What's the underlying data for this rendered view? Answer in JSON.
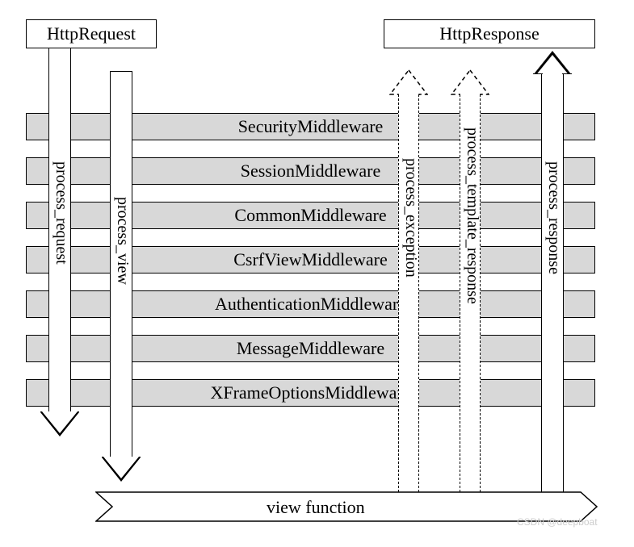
{
  "header": {
    "request_label": "HttpRequest",
    "response_label": "HttpResponse"
  },
  "middlewares": [
    "SecurityMiddleware",
    "SessionMiddleware",
    "CommonMiddleware",
    "CsrfViewMiddleware",
    "AuthenticationMiddleware",
    "MessageMiddleware",
    "XFrameOptionsMiddleware"
  ],
  "arrows": {
    "process_request": "process_request",
    "process_view": "process_view",
    "process_exception": "process_exception",
    "process_template_response": "process_template_response",
    "process_response": "process_response"
  },
  "footer": {
    "view_function": "view function"
  },
  "watermark": "CSDN @deepboat"
}
